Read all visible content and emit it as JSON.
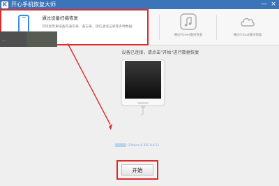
{
  "app": {
    "logo_letter": "K",
    "title": "开心手机恢复大师"
  },
  "window": {
    "minimize": "—",
    "close": "×"
  },
  "modes": {
    "active": {
      "icon": "phone-icon",
      "title": "通过设备扫描恢复",
      "desc": "可恢复苹果设备的通讯录、备忘录、短信通话记录等多种数据"
    },
    "itunes": {
      "icon": "music-note-icon",
      "label": "通过iTunes备份恢复"
    },
    "icloud": {
      "icon": "cloud-icon",
      "label": "通过iCloud备份恢复"
    }
  },
  "sidebar": {
    "thumb_text": "..."
  },
  "main": {
    "connect_text": "设备已连接，请点击\"开始\"进行数据恢复",
    "device_info": "(iPhone 6 iOS 8.4.1)",
    "start_label": "开始"
  },
  "colors": {
    "titlebar": "#3b74b8",
    "highlight": "#e02a2a",
    "link": "#7ca6d8"
  }
}
